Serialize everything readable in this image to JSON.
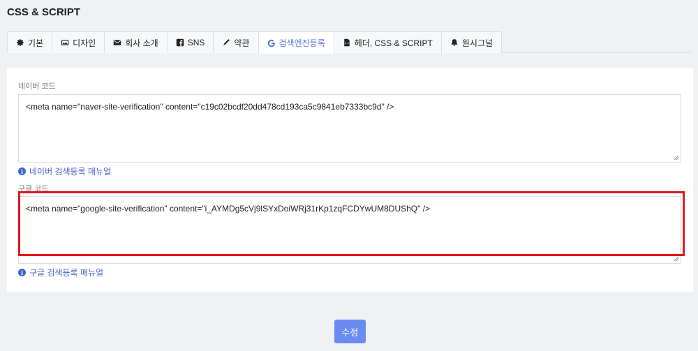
{
  "page": {
    "title": "CSS & SCRIPT"
  },
  "tabs": [
    {
      "label": "기본",
      "icon": "gear-icon",
      "active": false
    },
    {
      "label": "디자인",
      "icon": "image-icon",
      "active": false
    },
    {
      "label": "회사 소개",
      "icon": "envelope-icon",
      "active": false
    },
    {
      "label": "SNS",
      "icon": "facebook-icon",
      "active": false
    },
    {
      "label": "약관",
      "icon": "pen-icon",
      "active": false
    },
    {
      "label": "검색엔진등록",
      "icon": "google-icon",
      "active": true
    },
    {
      "label": "헤더, CSS & SCRIPT",
      "icon": "file-code-icon",
      "active": false
    },
    {
      "label": "원시그널",
      "icon": "bell-icon",
      "active": false
    }
  ],
  "naver": {
    "label": "네이버 코드",
    "code": "<meta name=\"naver-site-verification\" content=\"c19c02bcdf20dd478cd193ca5c9841eb7333bc9d\" />",
    "help": "네이버 검색등록 매뉴얼"
  },
  "google": {
    "label": "구글 코드",
    "code": "<meta name=\"google-site-verification\" content=\"i_AYMDg5cVj9lSYxDoiWRj31rKp1zqFCDYwUM8DUShQ\" />",
    "help": "구글 검색등록 매뉴얼"
  },
  "actions": {
    "submit_label": "수정"
  },
  "colors": {
    "accent": "#6a8bf0",
    "active_tab": "#5a7bd5",
    "link": "#4a66c9",
    "highlight": "#e0181c"
  }
}
